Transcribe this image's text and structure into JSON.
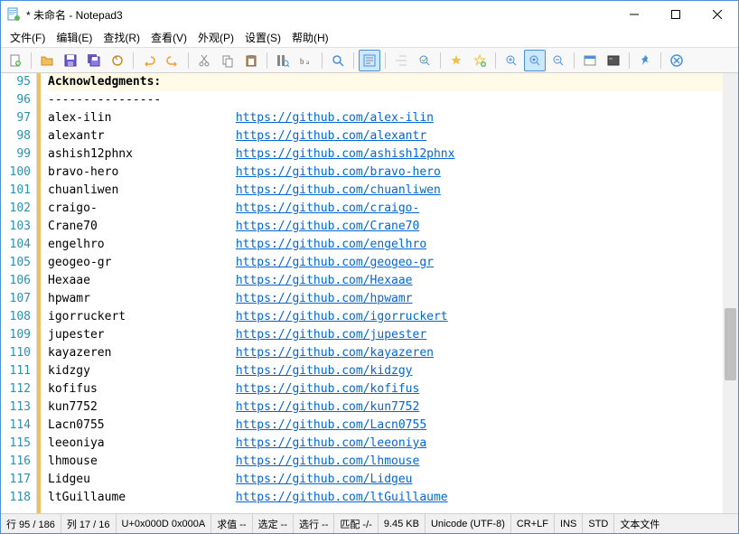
{
  "title": "* 未命名 - Notepad3",
  "menus": [
    "文件(F)",
    "编辑(E)",
    "查找(R)",
    "查看(V)",
    "外观(P)",
    "设置(S)",
    "帮助(H)"
  ],
  "header": {
    "ack": "Acknowledgments:",
    "sep": "----------------"
  },
  "contributors": [
    {
      "name": "alex-ilin",
      "url": "https://github.com/alex-ilin"
    },
    {
      "name": "alexantr",
      "url": "https://github.com/alexantr"
    },
    {
      "name": "ashish12phnx",
      "url": "https://github.com/ashish12phnx"
    },
    {
      "name": "bravo-hero",
      "url": "https://github.com/bravo-hero"
    },
    {
      "name": "chuanliwen",
      "url": "https://github.com/chuanliwen"
    },
    {
      "name": "craigo-",
      "url": "https://github.com/craigo-"
    },
    {
      "name": "Crane70",
      "url": "https://github.com/Crane70"
    },
    {
      "name": "engelhro",
      "url": "https://github.com/engelhro"
    },
    {
      "name": "geogeo-gr",
      "url": "https://github.com/geogeo-gr"
    },
    {
      "name": "Hexaae",
      "url": "https://github.com/Hexaae"
    },
    {
      "name": "hpwamr",
      "url": "https://github.com/hpwamr"
    },
    {
      "name": "igorruckert",
      "url": "https://github.com/igorruckert"
    },
    {
      "name": "jupester",
      "url": "https://github.com/jupester"
    },
    {
      "name": "kayazeren",
      "url": "https://github.com/kayazeren"
    },
    {
      "name": "kidzgy",
      "url": "https://github.com/kidzgy"
    },
    {
      "name": "kofifus",
      "url": "https://github.com/kofifus"
    },
    {
      "name": "kun7752",
      "url": "https://github.com/kun7752"
    },
    {
      "name": "Lacn0755",
      "url": "https://github.com/Lacn0755"
    },
    {
      "name": "leeoniya",
      "url": "https://github.com/leeoniya"
    },
    {
      "name": "lhmouse",
      "url": "https://github.com/lhmouse"
    },
    {
      "name": "Lidgeu",
      "url": "https://github.com/Lidgeu"
    },
    {
      "name": "ltGuillaume",
      "url": "https://github.com/ltGuillaume"
    }
  ],
  "line_start": 95,
  "status": {
    "line": "行  95 / 186",
    "col": "列  17 / 16",
    "unicode": "U+0x000D 0x000A",
    "val": "求值  --",
    "sel": "选定  --",
    "selln": "选行  --",
    "match": "匹配  -/-",
    "size": "9.45 KB",
    "enc": "Unicode (UTF-8)",
    "eol": "CR+LF",
    "ins": "INS",
    "std": "STD",
    "filetype": "文本文件"
  }
}
